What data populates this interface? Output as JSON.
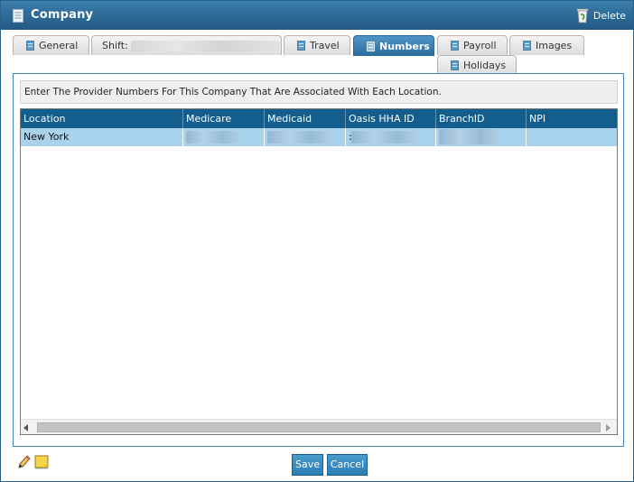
{
  "window": {
    "title": "Company",
    "delete_label": "Delete",
    "title_icon": "document-icon",
    "delete_icon": "recycle-bin-icon"
  },
  "tabs": [
    {
      "label": "General",
      "active": false
    },
    {
      "label": "Shift:",
      "active": false
    },
    {
      "label": "Travel",
      "active": false
    },
    {
      "label": "Numbers",
      "active": true
    },
    {
      "label": "Payroll",
      "active": false
    },
    {
      "label": "Images",
      "active": false
    },
    {
      "label": "Holidays",
      "active": false
    }
  ],
  "instruction": "Enter The Provider Numbers For This Company That Are Associated With Each Location.",
  "table": {
    "columns": [
      "Location",
      "Medicare",
      "Medicaid",
      "Oasis HHA ID",
      "BranchID",
      "NPI"
    ],
    "rows": [
      {
        "location": "New York",
        "medicare": "",
        "medicaid": "",
        "oasis": ":",
        "branch": "",
        "npi": ""
      }
    ]
  },
  "footer": {
    "save_label": "Save",
    "cancel_label": "Cancel",
    "edit_icon": "pencil-icon",
    "note_icon": "sticky-note-icon"
  },
  "colors": {
    "titlebar": "#2e6c99",
    "header": "#135e8c",
    "selected_row": "#a9d2ec",
    "button": "#2a7db3"
  }
}
